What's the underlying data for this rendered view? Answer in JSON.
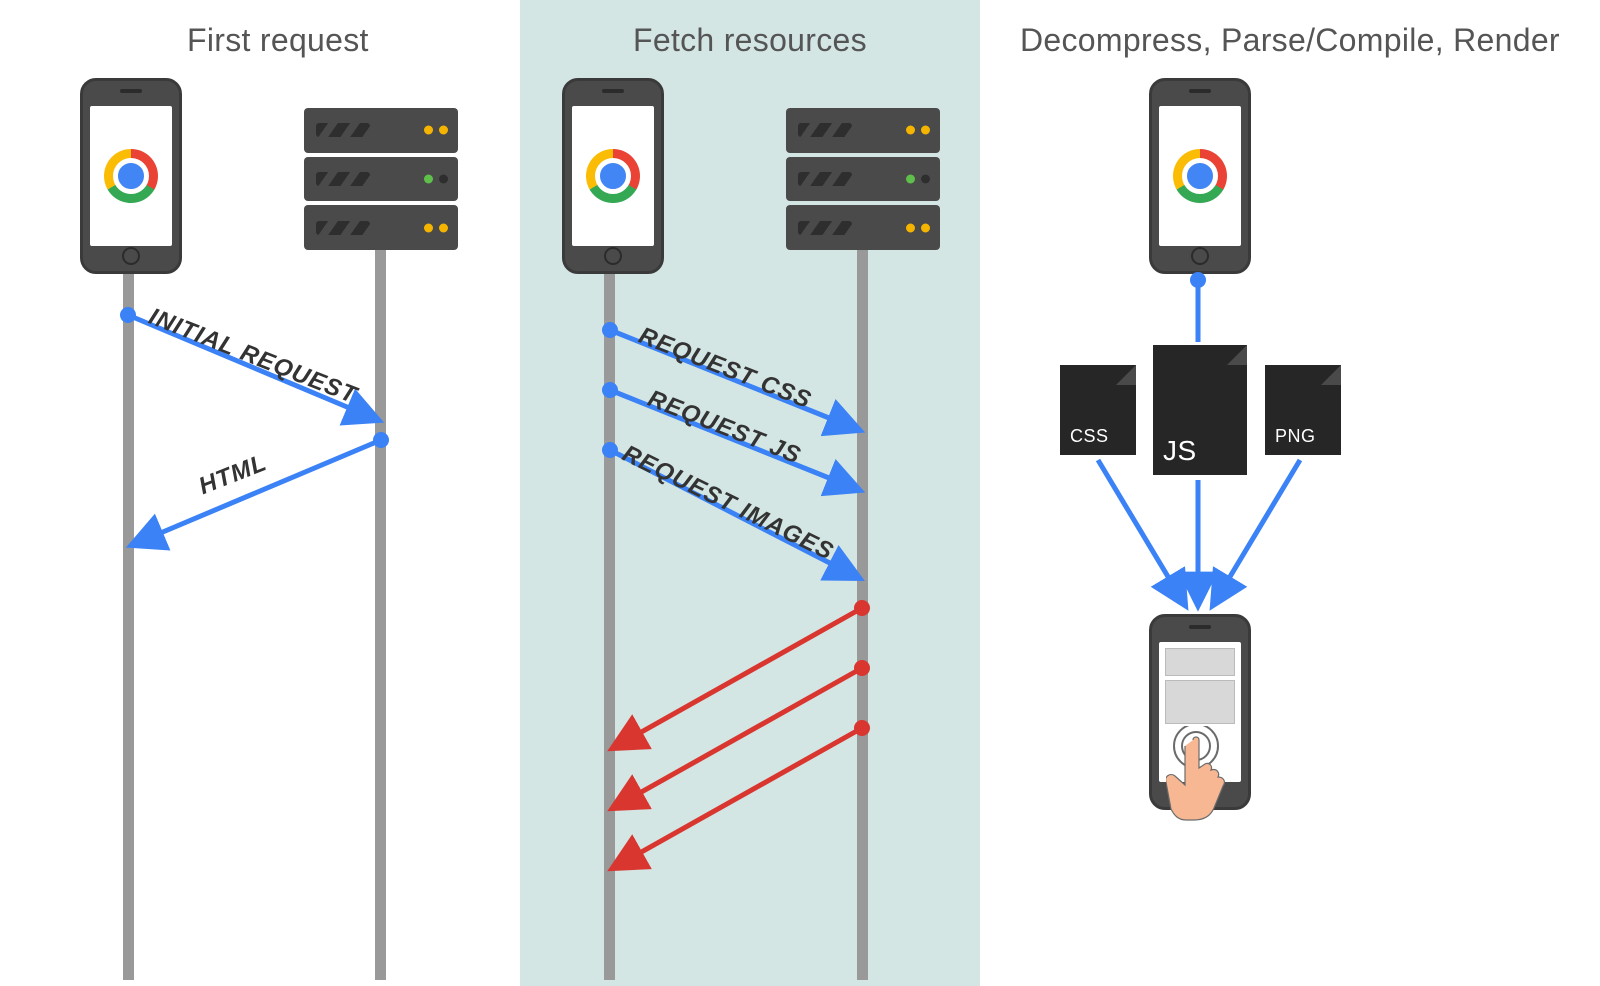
{
  "columns": {
    "first": "First request",
    "fetch": "Fetch resources",
    "render": "Decompress, Parse/Compile, Render"
  },
  "messages": {
    "initial": "INITIAL REQUEST",
    "html": "HTML",
    "reqCss": "REQUEST CSS",
    "reqJs": "REQUEST JS",
    "reqImg": "REQUEST IMAGES"
  },
  "files": {
    "css": "CSS",
    "js": "JS",
    "png": "PNG"
  },
  "colors": {
    "request": "#3b82f6",
    "response": "#d9362f",
    "highlight": "#d3e6e4"
  }
}
